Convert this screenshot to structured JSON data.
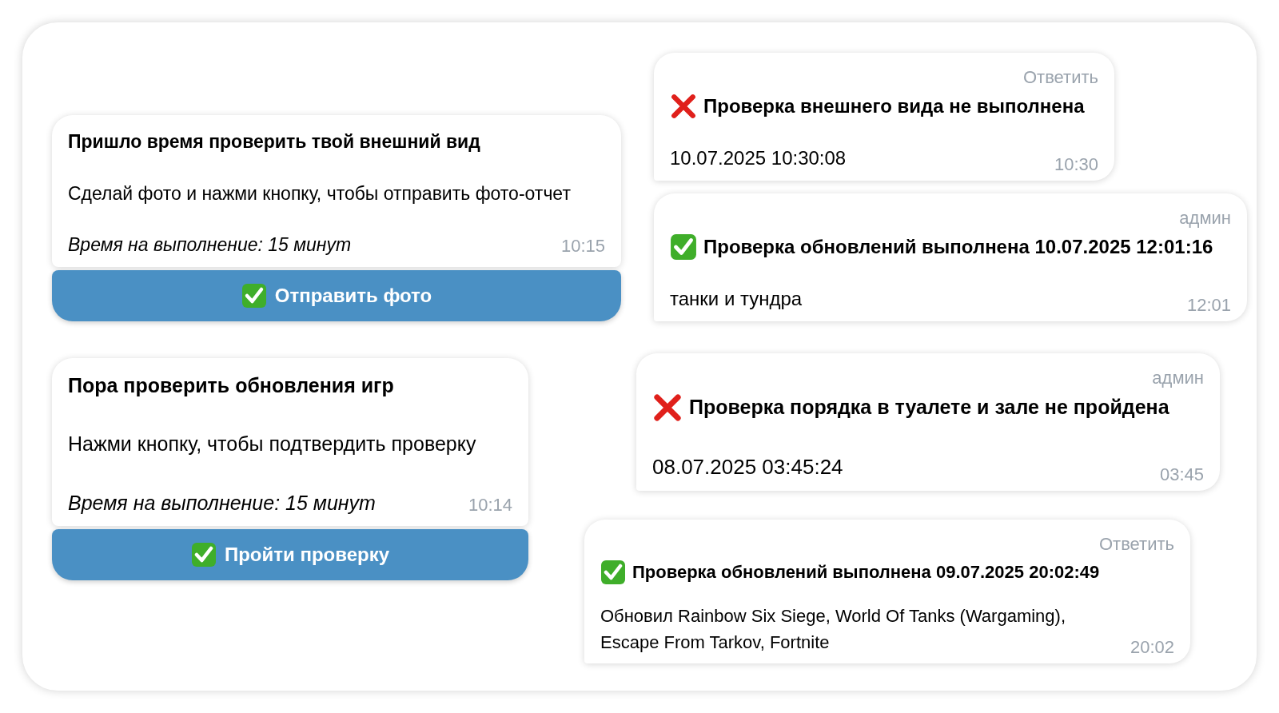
{
  "bot_messages": [
    {
      "title": "Пришло время проверить твой внешний вид",
      "body": "Сделай фото и нажми кнопку, чтобы отправить фото-отчет",
      "deadline": "Время на выполнение: 15 минут",
      "time": "10:15",
      "button": {
        "label": "Отправить фото"
      }
    },
    {
      "title": "Пора проверить обновления игр",
      "body": "Нажми кнопку, чтобы подтвердить проверку",
      "deadline": "Время на выполнение: 15 минут",
      "time": "10:14",
      "button": {
        "label": "Пройти проверку"
      }
    }
  ],
  "reports": [
    {
      "header": "Ответить",
      "kind": "failed",
      "title": "Проверка внешнего вида не выполнена",
      "body": "10.07.2025 10:30:08",
      "time": "10:30"
    },
    {
      "header": "админ",
      "kind": "passed",
      "title": "Проверка обновлений выполнена 10.07.2025 12:01:16",
      "body": "танки и тундра",
      "time": "12:01"
    },
    {
      "header": "админ",
      "kind": "failed",
      "title": "Проверка порядка в туалете и зале не пройдена",
      "body": "08.07.2025 03:45:24",
      "time": "03:45"
    },
    {
      "header": "Ответить",
      "kind": "passed",
      "title": "Проверка обновлений выполнена 09.07.2025 20:02:49",
      "body": "Обновил Rainbow Six Siege, World Of Tanks (Wargaming), Escape From Tarkov, Fortnite",
      "time": "20:02"
    }
  ]
}
